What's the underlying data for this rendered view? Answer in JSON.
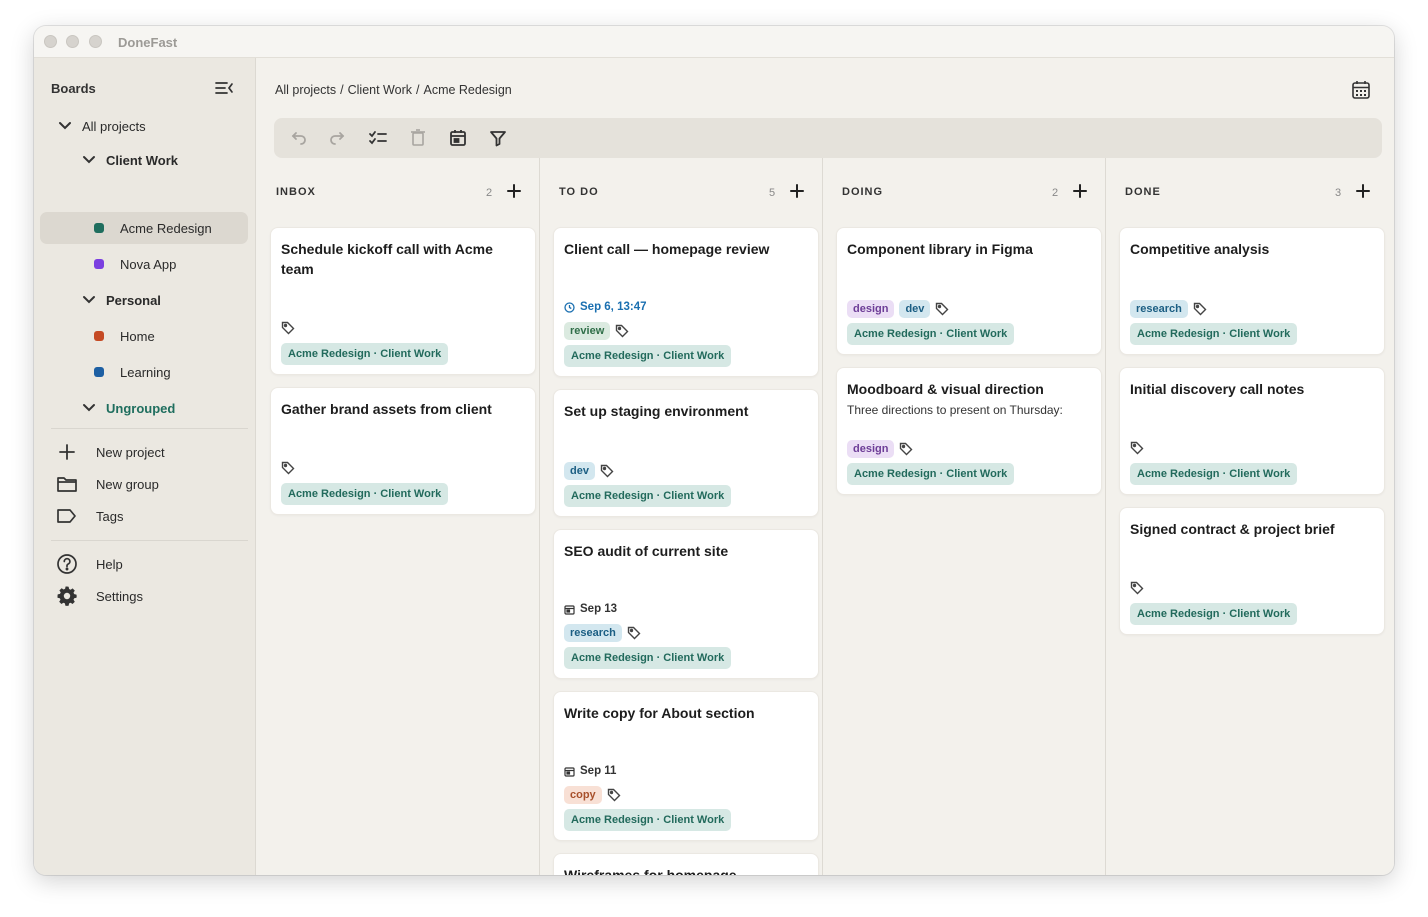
{
  "app": {
    "title": "DoneFast"
  },
  "sidebar": {
    "header": "Boards",
    "tree": {
      "all_projects": "All projects",
      "client_work": "Client Work",
      "acme": "Acme Redesign",
      "nova": "Nova App",
      "personal": "Personal",
      "home": "Home",
      "learning": "Learning",
      "ungrouped": "Ungrouped"
    },
    "colors": {
      "acme": "#1f6e5e",
      "nova": "#7b3fe0",
      "home": "#c54a24",
      "learning": "#1d5fa3",
      "ungrouped": "#1f6e5e"
    },
    "actions": {
      "new_project": "New project",
      "new_group": "New group",
      "tags": "Tags",
      "help": "Help",
      "settings": "Settings"
    }
  },
  "breadcrumb": {
    "root": "All projects",
    "sep": "/",
    "group": "Client Work",
    "project": "Acme Redesign"
  },
  "columns": {
    "inbox": {
      "title": "INBOX",
      "count": "2"
    },
    "todo": {
      "title": "TO DO",
      "count": "5"
    },
    "doing": {
      "title": "DOING",
      "count": "2"
    },
    "done": {
      "title": "DONE",
      "count": "3"
    }
  },
  "project_chip": "Acme Redesign · Client Work",
  "cards": {
    "inbox1": {
      "title": "Schedule kickoff call with Acme team"
    },
    "inbox2": {
      "title": "Gather brand assets from client"
    },
    "todo1": {
      "title": "Client call — homepage review",
      "date": "Sep 6, 13:47",
      "tags": [
        "review"
      ]
    },
    "todo2": {
      "title": "Set up staging environment",
      "tags": [
        "dev"
      ]
    },
    "todo3": {
      "title": "SEO audit of current site",
      "date": "Sep 13",
      "tags": [
        "research"
      ]
    },
    "todo4": {
      "title": "Write copy for About section",
      "date": "Sep 11",
      "tags": [
        "copy"
      ]
    },
    "todo5": {
      "title": "Wireframes for homepage"
    },
    "doing1": {
      "title": "Component library in Figma",
      "tags": [
        "design",
        "dev"
      ]
    },
    "doing2": {
      "title": "Moodboard & visual direction",
      "description": "Three directions to present on Thursday:",
      "tags": [
        "design"
      ]
    },
    "done1": {
      "title": "Competitive analysis",
      "tags": [
        "research"
      ]
    },
    "done2": {
      "title": "Initial discovery call notes"
    },
    "done3": {
      "title": "Signed contract & project brief"
    }
  }
}
